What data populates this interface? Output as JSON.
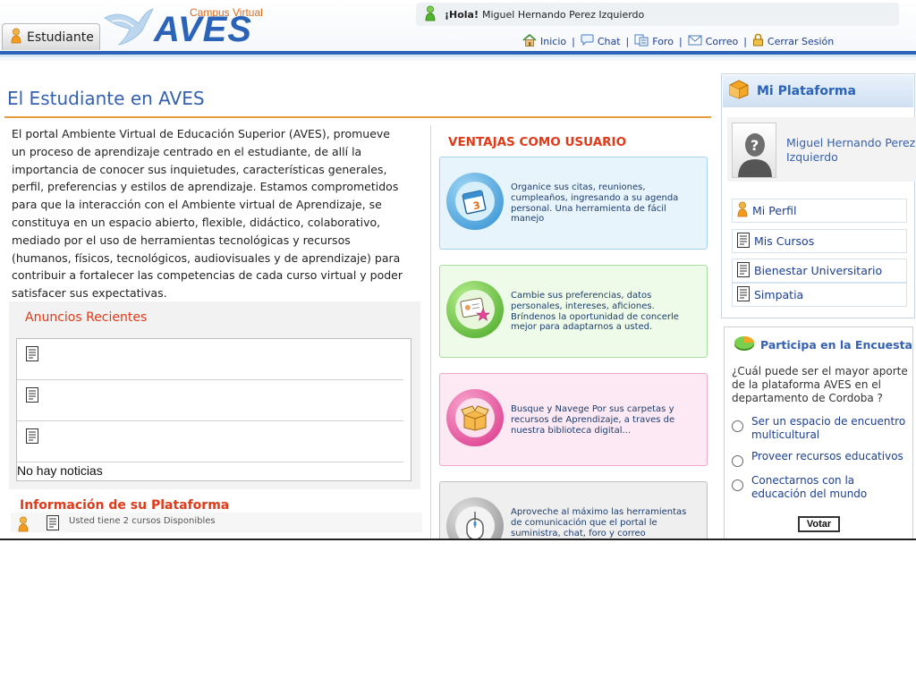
{
  "header": {
    "tab_label": "Estudiante",
    "logo_caption": "Campus Virtual",
    "logo_text": "AVES",
    "greeting_prefix": "¡Hola!",
    "greeting_name": "Miguel Hernando Perez Izquierdo",
    "links": [
      {
        "label": "Inicio",
        "icon": "home-icon"
      },
      {
        "label": "Chat",
        "icon": "chat-bubble-icon"
      },
      {
        "label": "Foro",
        "icon": "forum-icon"
      },
      {
        "label": "Correo",
        "icon": "mail-icon"
      },
      {
        "label": "Cerrar Sesión",
        "icon": "lock-icon"
      }
    ],
    "accent_color": "#2a63b8"
  },
  "main": {
    "title": "El Estudiante en AVES",
    "intro": "El portal Ambiente Virtual de Educación Superior (AVES), promueve un proceso de aprendizaje centrado en el estudiante, de allí la importancia de conocer sus inquietudes, características generales, perfil, preferencias y estilos de aprendizaje. Estamos comprometidos para que la interacción con el Ambiente virtual de Aprendizaje, se constituya en un espacio abierto, flexible, didáctico, colaborativo, mediado por el uso de herramientas tecnológicas y recursos (humanos, físicos, tecnológicos, audiovisuales y de aprendizaje) para contribuir a fortalecer las competencias de cada curso virtual y poder satisfacer sus expectativas.",
    "anuncios": {
      "title": "Anuncios Recientes",
      "empty_text": "No hay noticias"
    },
    "info": {
      "title": "Información de su Plataforma",
      "text": "Usted tiene 2 cursos Disponibles"
    }
  },
  "ventajas": {
    "title": "VENTAJAS COMO USUARIO",
    "cards": [
      {
        "icon": "calendar-icon",
        "text": "Organice sus citas, reuniones, cumpleaños, ingresando a su agenda personal. Una herramienta de fácil manejo"
      },
      {
        "icon": "profile-card-icon",
        "text": "Cambie sus preferencias, datos personales, intereses, aficiones. Bríndenos la oportunidad de concerle mejor para adaptarnos a usted."
      },
      {
        "icon": "open-box-icon",
        "text": "Busque y Navege Por sus carpetas y recursos de Aprendizaje, a traves de nuestra biblioteca digital..."
      },
      {
        "icon": "mouse-icon",
        "text": "Aproveche al máximo las herramientas de comunicación que el portal le suministra, chat, foro y correo"
      }
    ]
  },
  "sidebar": {
    "mi_plataforma": {
      "title": "Mi Plataforma",
      "user_name": "Miguel Hernando Perez Izquierdo",
      "items": [
        {
          "label": "Mi Perfil",
          "icon": "user-icon"
        },
        {
          "label": "Mis Cursos",
          "icon": "document-icon"
        },
        {
          "label": "Bienestar Universitario",
          "icon": "document-icon"
        },
        {
          "label": "Simpatia",
          "icon": "document-icon"
        }
      ]
    },
    "encuesta": {
      "title": "Participa en la Encuesta",
      "question": "¿Cuál puede ser el mayor aporte de la plataforma AVES en el departamento de Cordoba ?",
      "options": [
        "Ser un espacio de encuentro multicultural",
        "Proveer recursos educativos",
        "Conectarnos con la educación del mundo"
      ],
      "vote_label": "Votar"
    }
  }
}
